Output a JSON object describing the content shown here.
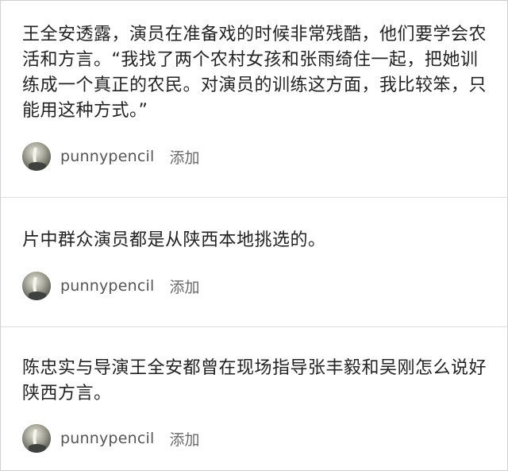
{
  "posts": [
    {
      "text": "王全安透露，演员在准备戏的时候非常残酷，他们要学会农活和方言。“我找了两个农村女孩和张雨绮住一起，把她训练成一个真正的农民。对演员的训练这方面，我比较笨，只能用这种方式。”",
      "username": "punnypencil",
      "action": "添加"
    },
    {
      "text": "片中群众演员都是从陕西本地挑选的。",
      "username": "punnypencil",
      "action": "添加"
    },
    {
      "text": "陈忠实与导演王全安都曾在现场指导张丰毅和吴刚怎么说好陕西方言。",
      "username": "punnypencil",
      "action": "添加"
    }
  ],
  "colors": {
    "text": "#222222",
    "username": "#555555",
    "action": "#6a6a6a",
    "divider": "#dedede"
  },
  "icons": {
    "avatar": "user-avatar-icon"
  }
}
